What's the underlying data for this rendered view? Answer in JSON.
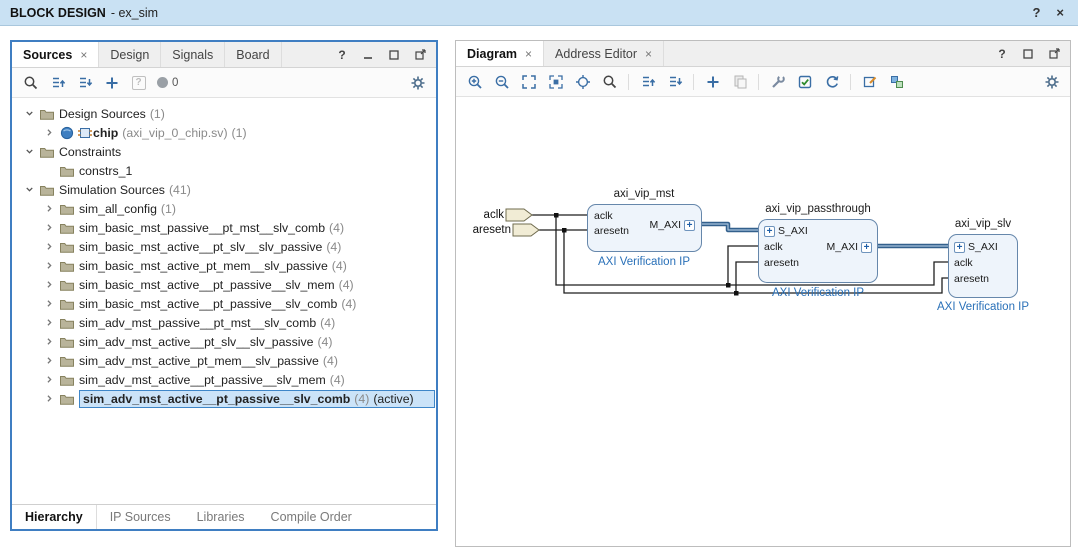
{
  "icons": {
    "close": "×",
    "help": "?"
  },
  "titlebar": {
    "title_bold": "BLOCK DESIGN",
    "title_rest": "- ex_sim"
  },
  "sources_panel": {
    "tabs": {
      "sources": "Sources",
      "design": "Design",
      "signals": "Signals",
      "board": "Board"
    },
    "toolbar": {
      "message_count": "0"
    },
    "tree": {
      "items": [
        {
          "label": "Design Sources",
          "count": "(1)"
        },
        {
          "label": "chip",
          "detail": "(axi_vip_0_chip.sv)",
          "count": "(1)"
        },
        {
          "label": "Constraints",
          "count": ""
        },
        {
          "label": "constrs_1",
          "count": ""
        },
        {
          "label": "Simulation Sources",
          "count": "(41)"
        },
        {
          "label": "sim_all_config",
          "count": "(1)"
        },
        {
          "label": "sim_basic_mst_passive__pt_mst__slv_comb",
          "count": "(4)"
        },
        {
          "label": "sim_basic_mst_active__pt_slv__slv_passive",
          "count": "(4)"
        },
        {
          "label": "sim_basic_mst_active_pt_mem__slv_passive",
          "count": "(4)"
        },
        {
          "label": "sim_basic_mst_active__pt_passive__slv_mem",
          "count": "(4)"
        },
        {
          "label": "sim_basic_mst_active__pt_passive__slv_comb",
          "count": "(4)"
        },
        {
          "label": "sim_adv_mst_passive__pt_mst__slv_comb",
          "count": "(4)"
        },
        {
          "label": "sim_adv_mst_active__pt_slv__slv_passive",
          "count": "(4)"
        },
        {
          "label": "sim_adv_mst_active_pt_mem__slv_passive",
          "count": "(4)"
        },
        {
          "label": "sim_adv_mst_active__pt_passive__slv_mem",
          "count": "(4)"
        },
        {
          "label": "sim_adv_mst_active__pt_passive__slv_comb",
          "count": "(4)",
          "status": "(active)"
        }
      ]
    },
    "bottom_tabs": {
      "hierarchy": "Hierarchy",
      "ip_sources": "IP Sources",
      "libraries": "Libraries",
      "compile_order": "Compile Order"
    }
  },
  "diagram_panel": {
    "tabs": {
      "diagram": "Diagram",
      "address_editor": "Address Editor"
    },
    "canvas": {
      "plus_glyph": "+",
      "external_ports": [
        {
          "name": "aclk"
        },
        {
          "name": "aresetn"
        }
      ],
      "blocks": [
        {
          "title": "axi_vip_mst",
          "type": "AXI Verification IP",
          "ports_left": [
            "aclk",
            "aresetn"
          ],
          "ports_right": [
            "M_AXI"
          ]
        },
        {
          "title": "axi_vip_passthrough",
          "type": "AXI Verification IP",
          "ports_left": [
            "S_AXI",
            "aclk",
            "aresetn"
          ],
          "ports_right": [
            "M_AXI"
          ]
        },
        {
          "title": "axi_vip_slv",
          "type": "AXI Verification IP",
          "ports_left": [
            "S_AXI",
            "aclk",
            "aresetn"
          ],
          "ports_right": []
        }
      ]
    }
  }
}
